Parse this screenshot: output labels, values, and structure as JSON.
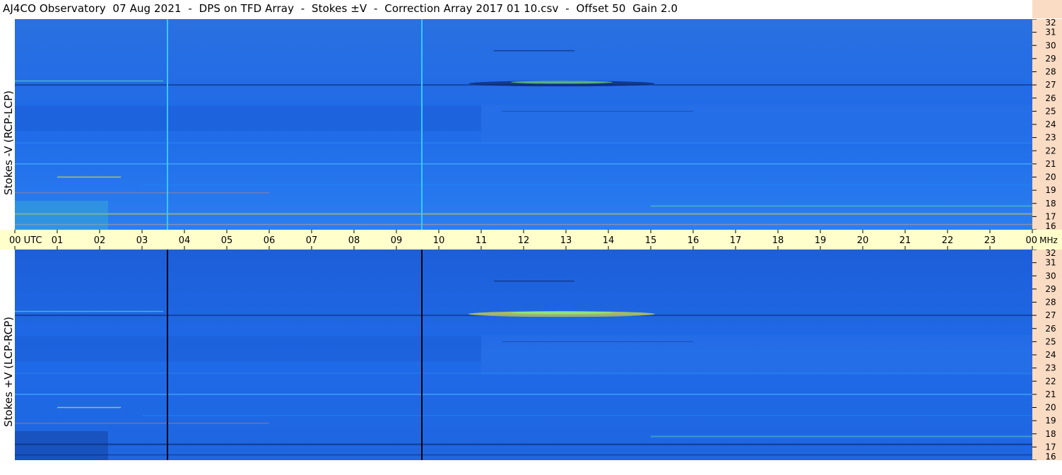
{
  "title": "AJ4CO Observatory  07 Aug 2021  -  DPS on TFD Array  -  Stokes ±V  -  Correction Array 2017 01 10.csv  -  Offset 50  Gain 2.0",
  "colors": {
    "background_blue": "#1e66e6",
    "axis_band": "#ffffcc",
    "freq_scale_band": "#fadbc4"
  },
  "chart_data": [
    {
      "type": "heatmap",
      "ylabel": "Stokes -V (RCP-LCP)",
      "x_ticks": [
        "00 UTC",
        "01",
        "02",
        "03",
        "04",
        "05",
        "06",
        "07",
        "08",
        "09",
        "10",
        "11",
        "12",
        "13",
        "14",
        "15",
        "16",
        "17",
        "18",
        "19",
        "20",
        "21",
        "22",
        "23",
        "00"
      ],
      "x_unit": "UTC",
      "xlim": [
        0,
        24
      ],
      "y_ticks": [
        "16",
        "17",
        "18",
        "19",
        "20",
        "21",
        "22",
        "23",
        "24",
        "25",
        "26",
        "27",
        "28",
        "29",
        "30",
        "31",
        "32"
      ],
      "y_unit": "MHz",
      "ylim": [
        16,
        32
      ],
      "vertical_markers_utc": [
        3.6,
        9.6
      ],
      "marker_color": "#33ccff"
    },
    {
      "type": "heatmap",
      "ylabel": "Stokes +V (LCP-RCP)",
      "x_ticks": [
        "00 UTC",
        "01",
        "02",
        "03",
        "04",
        "05",
        "06",
        "07",
        "08",
        "09",
        "10",
        "11",
        "12",
        "13",
        "14",
        "15",
        "16",
        "17",
        "18",
        "19",
        "20",
        "21",
        "22",
        "23",
        "00"
      ],
      "x_unit": "UTC",
      "xlim": [
        0,
        24
      ],
      "y_ticks": [
        "16",
        "17",
        "18",
        "19",
        "20",
        "21",
        "22",
        "23",
        "24",
        "25",
        "26",
        "27",
        "28",
        "29",
        "30",
        "31",
        "32"
      ],
      "y_unit": "MHz",
      "ylim": [
        16,
        32
      ],
      "vertical_markers_utc": [
        3.6,
        9.6
      ],
      "marker_color": "#000000"
    }
  ]
}
